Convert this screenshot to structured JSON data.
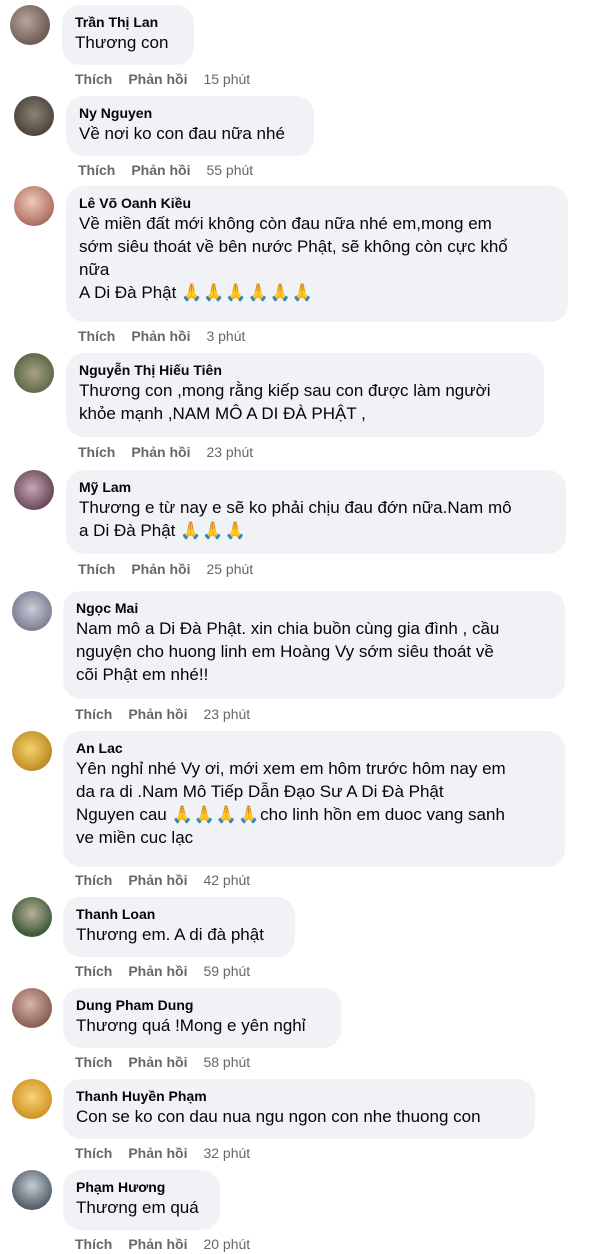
{
  "actions": {
    "like": "Thích",
    "reply": "Phản hồi"
  },
  "comments": [
    {
      "author": "Trần Thị Lan",
      "lines": [
        "Thương con"
      ],
      "time": "15 phút"
    },
    {
      "author": "Ny Nguyen",
      "lines": [
        "Về nơi ko con đau nữa nhé"
      ],
      "time": "55 phút"
    },
    {
      "author": "Lê Võ Oanh Kiều",
      "lines": [
        "Về miền đất mới không còn đau nữa nhé em,mong em",
        "sớm siêu thoát về bên nước Phật, sẽ không còn cực khổ",
        "nữa",
        "A Di Đà Phật "
      ],
      "emoji": "🙏🙏🙏🙏🙏🙏",
      "time": "3 phút"
    },
    {
      "author": "Nguyễn Thị Hiếu Tiên",
      "lines": [
        "Thương con ,mong rằng kiếp sau con được làm người",
        "khỏe mạnh ,NAM MÔ A DI ĐÀ PHẬT ,"
      ],
      "time": "23 phút"
    },
    {
      "author": "Mỹ Lam",
      "lines": [
        "Thương e từ nay e sẽ ko phải chịu đau đớn nữa.Nam mô",
        "a Di Đà Phật "
      ],
      "emoji": "🙏🙏🙏",
      "time": "25 phút"
    },
    {
      "author": "Ngọc Mai",
      "lines": [
        "Nam mô a Di Đà Phật. xin chia buồn cùng gia đình , cầu",
        "nguyện cho huong linh em Hoàng Vy sớm siêu thoát về",
        "cõi Phật em nhé!!"
      ],
      "time": "23 phút"
    },
    {
      "author": "An Lac",
      "lines": [
        "Yên nghỉ nhé Vy ơi, mới xem em hôm trước hôm nay em",
        "da ra di .Nam Mô Tiếp Dẫn Đạo Sư A Di Đà Phật",
        "Nguyen cau ",
        "ve miền cuc lạc"
      ],
      "emoji": "🙏🙏🙏🙏",
      "emoji_suffix": "cho linh hồn em duoc vang sanh",
      "time": "42 phút"
    },
    {
      "author": "Thanh Loan",
      "lines": [
        "Thương em. A di đà phật"
      ],
      "time": "59 phút"
    },
    {
      "author": "Dung Pham Dung",
      "lines": [
        "Thương quá !Mong e yên nghỉ"
      ],
      "time": "58 phút"
    },
    {
      "author": "Thanh Huyền Phạm",
      "lines": [
        "Con se ko con dau nua ngu ngon con nhe thuong con"
      ],
      "time": "32 phút"
    },
    {
      "author": "Phạm Hương",
      "lines": [
        "Thương em quá"
      ],
      "time": "20 phút"
    }
  ],
  "colors": {
    "bubble": "#f0f2f5",
    "meta": "#65676b",
    "text": "#050505"
  }
}
